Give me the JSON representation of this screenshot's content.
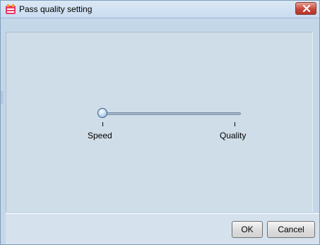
{
  "window": {
    "title": "Pass quality setting",
    "app_icon": "app-icon",
    "close_icon": "close-icon"
  },
  "slider": {
    "min_label": "Speed",
    "max_label": "Quality",
    "value": 0
  },
  "buttons": {
    "ok_label": "OK",
    "cancel_label": "Cancel"
  },
  "colors": {
    "window_bg": "#c4d7e8",
    "content_bg": "#cfdde8",
    "close_button": "#c7473a"
  }
}
